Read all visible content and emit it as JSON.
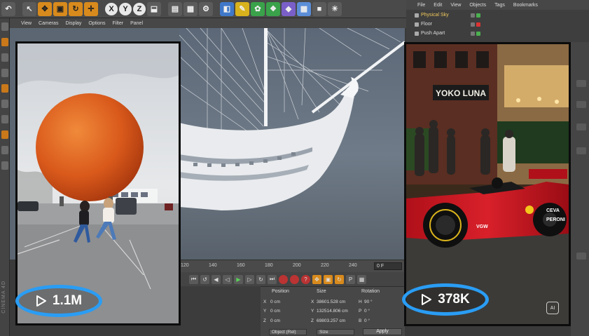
{
  "c4d": {
    "brand": "CINEMA 4D",
    "toolbar": {
      "axis_x": "X",
      "axis_y": "Y",
      "axis_z": "Z"
    },
    "viewport_menu": [
      "View",
      "Cameras",
      "Display",
      "Options",
      "Filter",
      "Panel"
    ],
    "object_manager_menu": [
      "File",
      "Edit",
      "View",
      "Objects",
      "Tags",
      "Bookmarks"
    ],
    "objects": [
      {
        "name": "Physical Sky",
        "selected": true
      },
      {
        "name": "Floor",
        "selected": false
      },
      {
        "name": "Push Apart",
        "selected": false
      }
    ],
    "timeline": {
      "ticks": [
        "120",
        "140",
        "160",
        "180",
        "200",
        "220",
        "240"
      ],
      "frame": "0 F"
    },
    "coordinates": {
      "headers": {
        "position": "Position",
        "size": "Size",
        "rotation": "Rotation"
      },
      "rows": [
        {
          "axis": "X",
          "pos": "0 cm",
          "size_axis": "X",
          "size": "38601.528 cm",
          "rot_axis": "H",
          "rot": "90 °"
        },
        {
          "axis": "Y",
          "pos": "0 cm",
          "size_axis": "Y",
          "size": "132514.806 cm",
          "rot_axis": "P",
          "rot": "0 °"
        },
        {
          "axis": "Z",
          "pos": "0 cm",
          "size_axis": "Z",
          "size": "69803.257 cm",
          "rot_axis": "B",
          "rot": "0 °"
        }
      ],
      "mode_select": "Object (Rel)",
      "size_select": "Size",
      "apply": "Apply"
    }
  },
  "videos": {
    "left": {
      "views": "1.1M",
      "play_icon": "play-icon"
    },
    "right": {
      "views": "378K",
      "play_icon": "play-icon",
      "sign": "YOKO LUNA",
      "car_text": [
        "CEVA",
        "PERONI",
        "VGW"
      ],
      "ai_badge": "AI"
    }
  },
  "colors": {
    "pill_border": "#2a9df4",
    "c4d_orange": "#d88a1c",
    "selected_object": "#f1c95c"
  }
}
